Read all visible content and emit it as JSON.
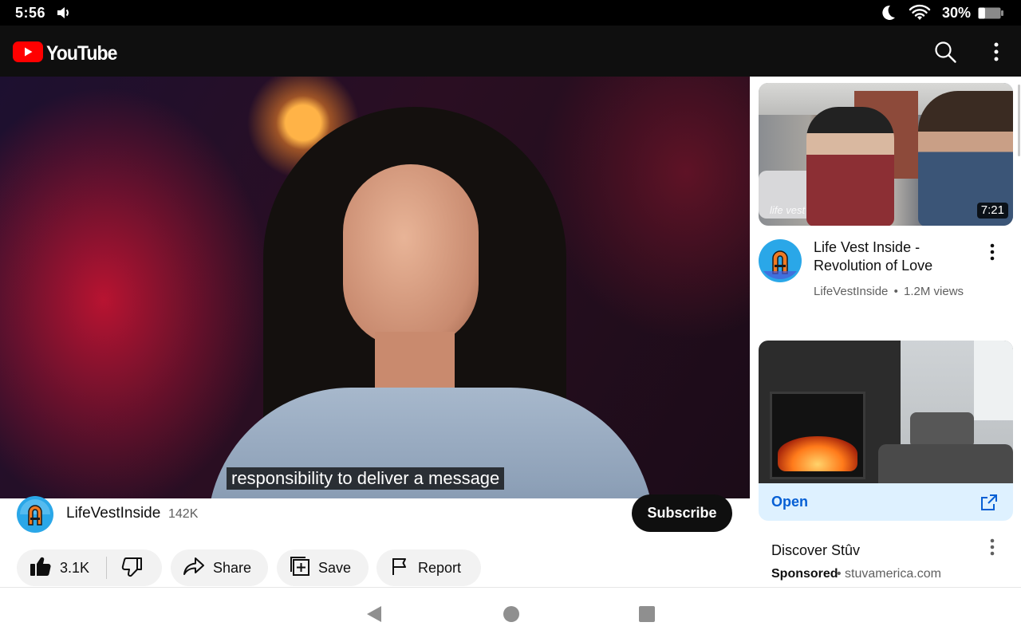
{
  "status_bar": {
    "time": "5:56",
    "battery_percent": "30%",
    "battery_level": 0.3,
    "icons": [
      "volume-icon",
      "moon-icon",
      "wifi-icon",
      "battery-icon"
    ]
  },
  "app_bar": {
    "logo_text": "YouTube",
    "brand_color": "#ff0000",
    "icons": [
      "search-icon",
      "more-vert-icon"
    ]
  },
  "player": {
    "caption": "responsibility to deliver a message"
  },
  "channel": {
    "name": "LifeVestInside",
    "subscribers": "142K",
    "subscribe_label": "Subscribe"
  },
  "actions": {
    "like_count": "3.1K",
    "share_label": "Share",
    "save_label": "Save",
    "report_label": "Report"
  },
  "up_next": {
    "duration": "7:21",
    "thumbnail_watermark": "life vest",
    "title": "Life Vest Inside - Revolution of Love",
    "channel": "LifeVestInside",
    "separator": "•",
    "views": "1.2M views"
  },
  "ad": {
    "open_label": "Open",
    "title": "Discover Stûv",
    "sponsored_label": "Sponsored",
    "separator": "•",
    "domain": "stuvamerica.com",
    "accent_color": "#065fd4",
    "button_bg": "#def1ff"
  },
  "nav_bar": {
    "icons": [
      "back-icon",
      "home-icon",
      "recents-icon"
    ]
  }
}
